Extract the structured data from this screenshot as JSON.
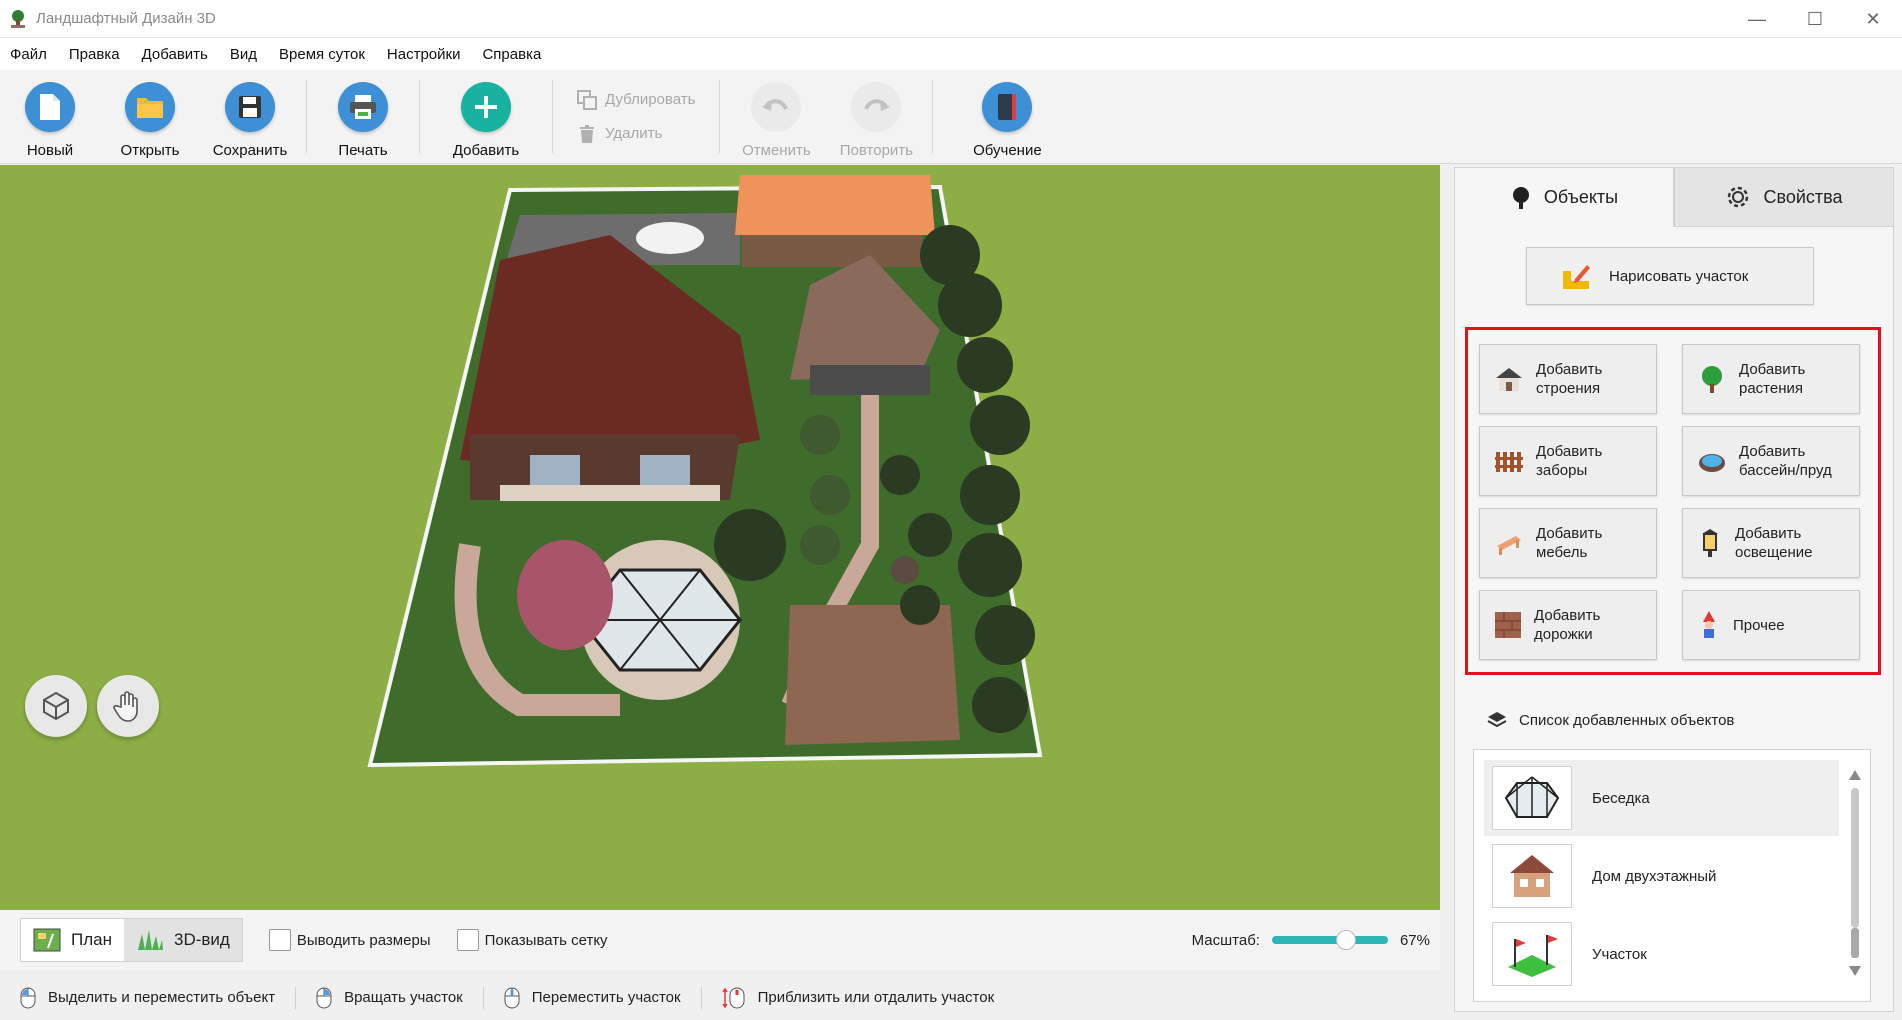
{
  "window": {
    "title": "Ландшафтный Дизайн 3D",
    "minimize": "—",
    "maximize": "☐",
    "close": "✕"
  },
  "menu": [
    "Файл",
    "Правка",
    "Добавить",
    "Вид",
    "Время суток",
    "Настройки",
    "Справка"
  ],
  "toolbar": {
    "new": "Новый",
    "open": "Открыть",
    "save": "Сохранить",
    "print": "Печать",
    "add": "Добавить",
    "duplicate": "Дублировать",
    "delete": "Удалить",
    "undo": "Отменить",
    "redo": "Повторить",
    "tutorial": "Обучение"
  },
  "viewbar": {
    "plan": "План",
    "view3d": "3D-вид",
    "show_dimensions": "Выводить размеры",
    "show_grid": "Показывать сетку",
    "scale_label": "Масштаб:",
    "scale_value": "67%",
    "scale_fraction": 0.67
  },
  "status": {
    "select_move": "Выделить и переместить объект",
    "rotate": "Вращать участок",
    "move_plot": "Переместить участок",
    "zoom": "Приблизить или отдалить участок"
  },
  "panel": {
    "tab_objects": "Объекты",
    "tab_properties": "Свойства",
    "draw_plot": "Нарисовать участок",
    "add_buttons": [
      {
        "label1": "Добавить",
        "label2": "строения"
      },
      {
        "label1": "Добавить",
        "label2": "растения"
      },
      {
        "label1": "Добавить",
        "label2": "заборы"
      },
      {
        "label1": "Добавить",
        "label2": "бассейн/пруд"
      },
      {
        "label1": "Добавить",
        "label2": "мебель"
      },
      {
        "label1": "Добавить",
        "label2": "освещение"
      },
      {
        "label1": "Добавить",
        "label2": "дорожки"
      },
      {
        "label1": "Прочее",
        "label2": ""
      }
    ],
    "list_title": "Список добавленных объектов",
    "list_items": [
      "Беседка",
      "Дом двухэтажный",
      "Участок"
    ]
  },
  "colors": {
    "accent_teal": "#2bb5b5",
    "highlight_red": "#e3101e",
    "lawn": "#8cae45"
  }
}
